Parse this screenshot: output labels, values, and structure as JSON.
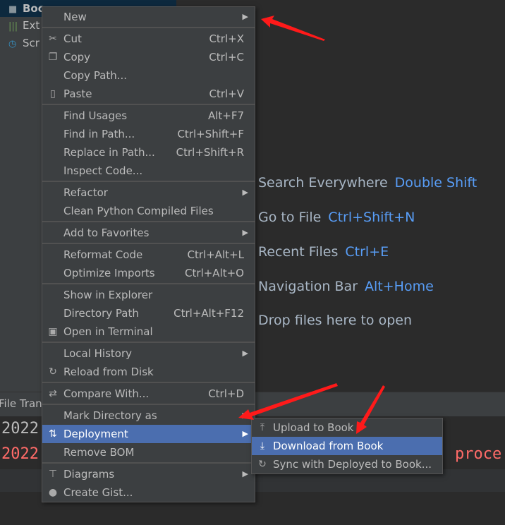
{
  "sidebar": {
    "items": [
      {
        "label": "Boo",
        "icon": "folder-icon",
        "selected": true
      },
      {
        "label": "Ext",
        "icon": "external-libraries-icon"
      },
      {
        "label": "Scr",
        "icon": "scratches-icon"
      }
    ]
  },
  "editor": {
    "hints": [
      {
        "label": "Search Everywhere",
        "key": "Double Shift"
      },
      {
        "label": "Go to File",
        "key": "Ctrl+Shift+N"
      },
      {
        "label": "Recent Files",
        "key": "Ctrl+E"
      },
      {
        "label": "Navigation Bar",
        "key": "Alt+Home"
      },
      {
        "label": "Drop files here to open",
        "key": ""
      }
    ]
  },
  "bottom": {
    "tab": "File Trans",
    "lines": [
      "2022",
      "2022"
    ],
    "tail": "proce"
  },
  "context_menu": {
    "items": [
      {
        "label": "New",
        "submenu": true
      },
      {
        "sep": true
      },
      {
        "label": "Cut",
        "shortcut": "Ctrl+X",
        "icon": "scissors-icon"
      },
      {
        "label": "Copy",
        "shortcut": "Ctrl+C",
        "icon": "copy-icon"
      },
      {
        "label": "Copy Path...",
        "shortcut": ""
      },
      {
        "label": "Paste",
        "shortcut": "Ctrl+V",
        "icon": "paste-icon"
      },
      {
        "sep": true
      },
      {
        "label": "Find Usages",
        "shortcut": "Alt+F7"
      },
      {
        "label": "Find in Path...",
        "shortcut": "Ctrl+Shift+F"
      },
      {
        "label": "Replace in Path...",
        "shortcut": "Ctrl+Shift+R"
      },
      {
        "label": "Inspect Code..."
      },
      {
        "sep": true
      },
      {
        "label": "Refactor",
        "submenu": true
      },
      {
        "label": "Clean Python Compiled Files"
      },
      {
        "sep": true
      },
      {
        "label": "Add to Favorites",
        "submenu": true
      },
      {
        "sep": true
      },
      {
        "label": "Reformat Code",
        "shortcut": "Ctrl+Alt+L"
      },
      {
        "label": "Optimize Imports",
        "shortcut": "Ctrl+Alt+O"
      },
      {
        "sep": true
      },
      {
        "label": "Show in Explorer"
      },
      {
        "label": "Directory Path",
        "shortcut": "Ctrl+Alt+F12"
      },
      {
        "label": "Open in Terminal",
        "icon": "terminal-icon"
      },
      {
        "sep": true
      },
      {
        "label": "Local History",
        "submenu": true
      },
      {
        "label": "Reload from Disk",
        "icon": "reload-icon"
      },
      {
        "sep": true
      },
      {
        "label": "Compare With...",
        "shortcut": "Ctrl+D",
        "icon": "compare-icon"
      },
      {
        "sep": true
      },
      {
        "label": "Mark Directory as",
        "submenu": true
      },
      {
        "label": "Deployment",
        "submenu": true,
        "icon": "deployment-icon",
        "selected": true
      },
      {
        "label": "Remove BOM"
      },
      {
        "sep": true
      },
      {
        "label": "Diagrams",
        "submenu": true,
        "icon": "diagrams-icon"
      },
      {
        "label": "Create Gist...",
        "icon": "github-icon"
      }
    ]
  },
  "deployment_submenu": {
    "items": [
      {
        "label": "Upload to Book",
        "icon": "upload-icon"
      },
      {
        "label": "Download from Book",
        "icon": "download-icon",
        "selected": true
      },
      {
        "label": "Sync with Deployed to Book...",
        "icon": "sync-icon"
      }
    ]
  },
  "colors": {
    "accent": "#4b6eaf",
    "shortcut_blue": "#589df6",
    "error_red": "#ff6b68",
    "annotation_arrow": "#ff1a1a"
  }
}
